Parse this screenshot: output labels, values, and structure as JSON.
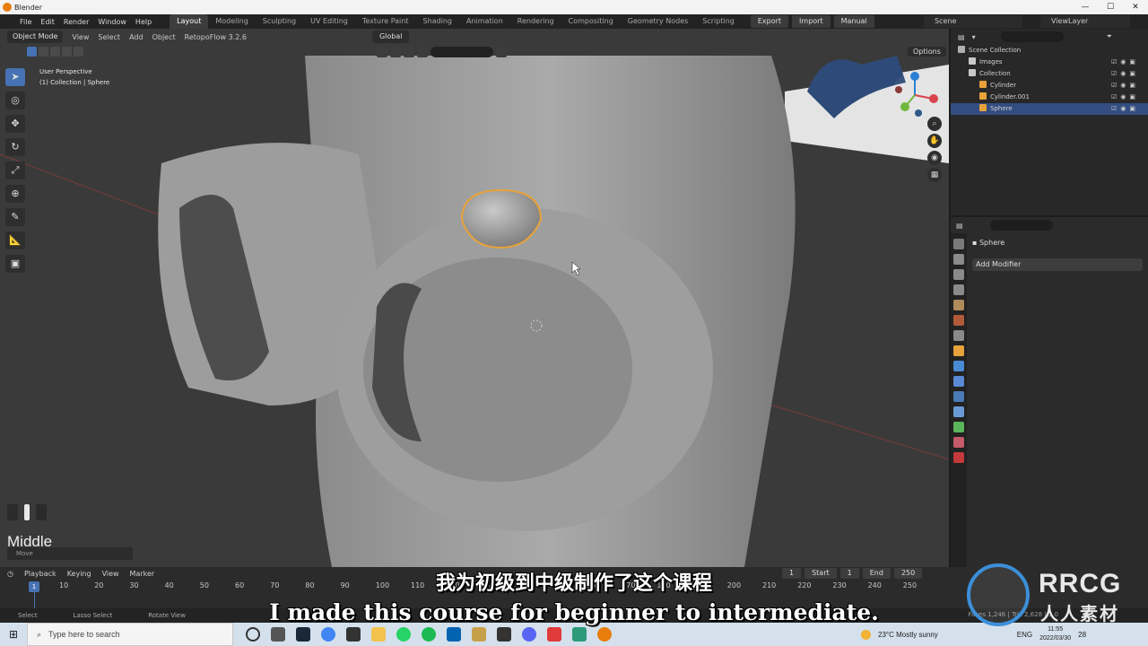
{
  "window": {
    "title": "Blender",
    "buttons": [
      "—",
      "☐",
      "✕"
    ]
  },
  "menu": [
    "File",
    "Edit",
    "Render",
    "Window",
    "Help"
  ],
  "workspaces": [
    "Layout",
    "Modeling",
    "Sculpting",
    "UV Editing",
    "Texture Paint",
    "Shading",
    "Animation",
    "Rendering",
    "Compositing",
    "Geometry Nodes",
    "Scripting"
  ],
  "extras": [
    "Export",
    "Import",
    "Manual"
  ],
  "scene": "Scene",
  "view_layer": "ViewLayer",
  "viewport": {
    "mode": "Object Mode",
    "menus": [
      "View",
      "Select",
      "Add",
      "Object"
    ],
    "addon": "RetopoFlow 3.2.6",
    "orientation": "Global",
    "options_label": "Options",
    "overlay_line1": "User Perspective",
    "overlay_line2": "(1) Collection | Sphere",
    "operator_key": "Middle",
    "last_op": "Move"
  },
  "toolbar_icons": [
    "cursor-select",
    "3d-cursor",
    "move",
    "rotate",
    "scale",
    "transform",
    "annotate",
    "measure",
    "add-cube"
  ],
  "outliner": {
    "rows": [
      {
        "label": "Scene Collection",
        "indent": 0,
        "icon_color": "#b0b0b0",
        "selected": false
      },
      {
        "label": "Images",
        "indent": 1,
        "icon_color": "#c8c8c8",
        "selected": false
      },
      {
        "label": "Collection",
        "indent": 1,
        "icon_color": "#c8c8c8",
        "selected": false
      },
      {
        "label": "Cylinder",
        "indent": 2,
        "icon_color": "#e8a23a",
        "selected": false
      },
      {
        "label": "Cylinder.001",
        "indent": 2,
        "icon_color": "#e8a23a",
        "selected": false
      },
      {
        "label": "Sphere",
        "indent": 2,
        "icon_color": "#e8a23a",
        "selected": true
      }
    ]
  },
  "properties": {
    "object_name": "Sphere",
    "add_modifier": "Add Modifier"
  },
  "timeline": {
    "menus": [
      "Playback",
      "Keying",
      "View",
      "Marker"
    ],
    "current_frame": "1",
    "start_label": "Start",
    "start": "1",
    "end_label": "End",
    "end": "250",
    "ruler": [
      "10",
      "20",
      "30",
      "40",
      "50",
      "60",
      "70",
      "80",
      "90",
      "100",
      "110",
      "120",
      "130",
      "140",
      "150",
      "160",
      "170",
      "180",
      "190",
      "200",
      "210",
      "220",
      "230",
      "240",
      "250"
    ],
    "playhead": "1"
  },
  "statusbar": {
    "items": [
      "Select",
      "Lasso Select",
      "Rotate View"
    ],
    "stats": "Faces 1,246 | Tris 2,628 | 3.0"
  },
  "taskbar": {
    "search_placeholder": "Type here to search",
    "weather": "23°C  Mostly sunny",
    "lang": "ENG",
    "time": "11:55",
    "date": "2022/03/30",
    "notifications": "28"
  },
  "subtitles": {
    "cn": "我为初级到中级制作了这个课程",
    "en": "I made this course for beginner to intermediate."
  },
  "watermark": {
    "brand": "RRCG",
    "brand_cn": "人人素材",
    "corner": "RRCG"
  },
  "colors": {
    "accent": "#4772b3",
    "selection": "#e8a23a",
    "viewport_bg": "#3a3a3a"
  }
}
